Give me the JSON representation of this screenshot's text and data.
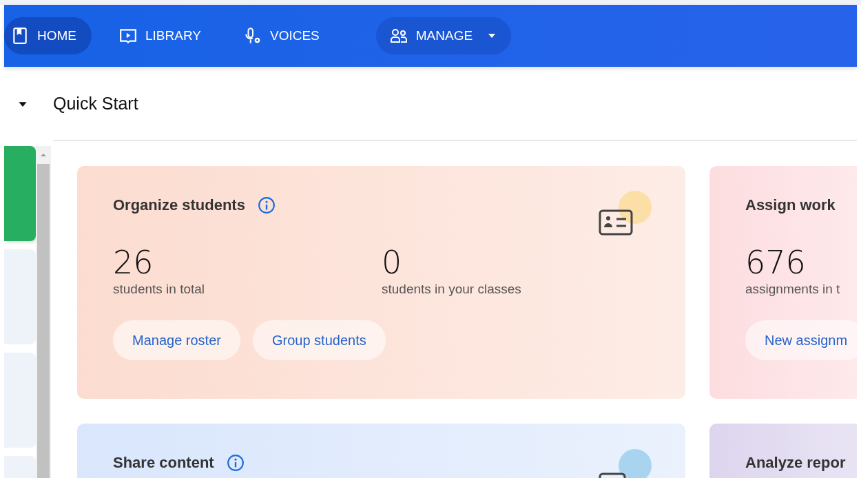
{
  "nav": {
    "tabs": [
      {
        "label": "HOME",
        "selected": true,
        "kind": "link"
      },
      {
        "label": "LIBRARY",
        "selected": false,
        "kind": "link"
      },
      {
        "label": "VOICES",
        "selected": false,
        "kind": "link"
      },
      {
        "label": "MANAGE",
        "selected": false,
        "kind": "dropdown"
      }
    ]
  },
  "sidebar": {
    "items": [
      {
        "selected": true
      },
      {
        "selected": false
      },
      {
        "selected": false
      },
      {
        "selected": false
      }
    ]
  },
  "section": {
    "title": "Quick Start",
    "expanded": true
  },
  "cards": [
    {
      "title": "Organize students",
      "info": true,
      "color": "#fcdcd0",
      "stats": [
        {
          "value": "26",
          "label": "students in total"
        },
        {
          "value": "0",
          "label": "students in your classes"
        }
      ],
      "buttons": [
        "Manage roster",
        "Group students"
      ]
    },
    {
      "title": "Assign work",
      "info": false,
      "color": "#fddde0",
      "stats": [
        {
          "value": "676",
          "label": "assignments in t"
        }
      ],
      "buttons": [
        "New assignm"
      ]
    },
    {
      "title": "Share content",
      "info": true,
      "color": "#d9e6fc"
    },
    {
      "title": "Analyze repor",
      "info": false,
      "color": "#ddd5ee"
    }
  ]
}
